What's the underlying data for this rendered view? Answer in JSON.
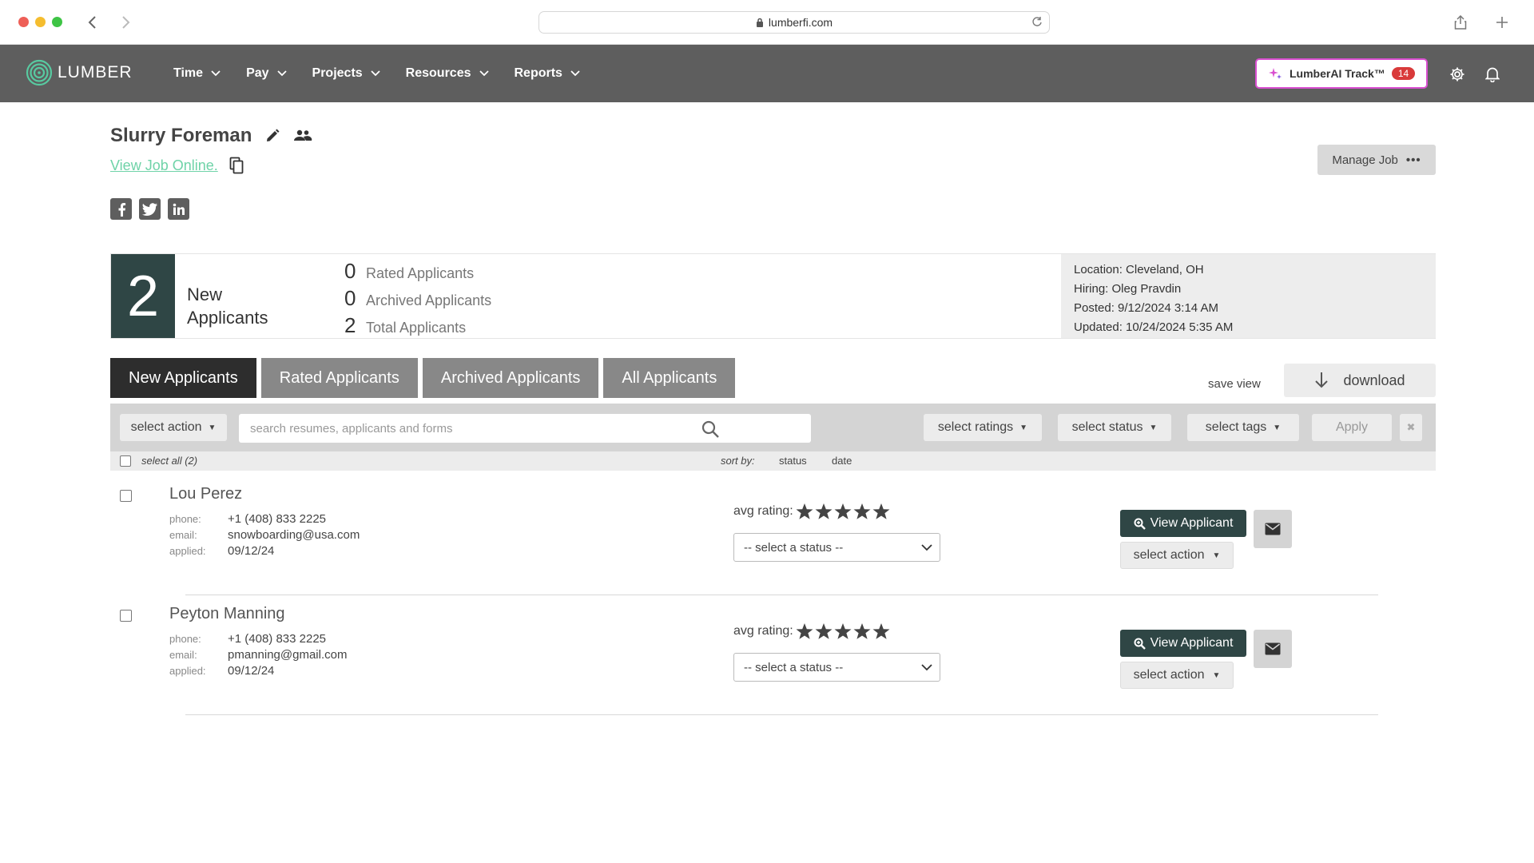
{
  "browser": {
    "url": "lumberfi.com"
  },
  "app": {
    "brand": "LUMBER",
    "menu": [
      {
        "label": "Time"
      },
      {
        "label": "Pay"
      },
      {
        "label": "Projects"
      },
      {
        "label": "Resources"
      },
      {
        "label": "Reports"
      }
    ],
    "ai_track": {
      "label": "LumberAI Track™",
      "badge": "14"
    }
  },
  "job": {
    "title": "Slurry Foreman",
    "view_online": "View Job Online.",
    "manage_label": "Manage Job",
    "manage_dots": "•••"
  },
  "summary": {
    "new_count": "2",
    "new_label_1": "New",
    "new_label_2": "Applicants",
    "stats": [
      {
        "count": "0",
        "label": "Rated Applicants"
      },
      {
        "count": "0",
        "label": "Archived Applicants"
      },
      {
        "count": "2",
        "label": "Total Applicants"
      }
    ],
    "meta": {
      "location": "Location: Cleveland, OH",
      "hiring": "Hiring: Oleg Pravdin",
      "posted": "Posted: 9/12/2024 3:14 AM",
      "updated": "Updated: 10/24/2024 5:35 AM"
    }
  },
  "tabs": [
    {
      "label": "New Applicants",
      "active": true
    },
    {
      "label": "Rated Applicants",
      "active": false
    },
    {
      "label": "Archived Applicants",
      "active": false
    },
    {
      "label": "All Applicants",
      "active": false
    }
  ],
  "toolbar": {
    "save_view": "save view",
    "download": "download",
    "select_action": "select action",
    "search_placeholder": "search resumes, applicants and forms",
    "select_ratings": "select ratings",
    "select_status": "select status",
    "select_tags": "select tags",
    "apply": "Apply",
    "clear": "✖"
  },
  "listbar": {
    "select_all": "select all (2)",
    "sort_by": "sort by:",
    "sort_status": "status",
    "sort_date": "date"
  },
  "applicants": [
    {
      "name": "Lou Perez",
      "phone_label": "phone:",
      "phone": "+1 (408) 833 2225",
      "email_label": "email:",
      "email": "snowboarding@usa.com",
      "applied_label": "applied:",
      "applied": "09/12/24",
      "avg_label": "avg rating:",
      "rating": 0,
      "status_placeholder": "-- select a status --",
      "view_label": "View Applicant",
      "action_label": "select action"
    },
    {
      "name": "Peyton Manning",
      "phone_label": "phone:",
      "phone": "+1 (408) 833 2225",
      "email_label": "email:",
      "email": "pmanning@gmail.com",
      "applied_label": "applied:",
      "applied": "09/12/24",
      "avg_label": "avg rating:",
      "rating": 0,
      "status_placeholder": "-- select a status --",
      "view_label": "View Applicant",
      "action_label": "select action"
    }
  ],
  "colors": {
    "nav_bg": "#5e5e5e",
    "accent_dark": "#2f4645",
    "link_green": "#6fd3a8",
    "ai_border": "#d94fd0",
    "badge_red": "#d93a3a"
  }
}
